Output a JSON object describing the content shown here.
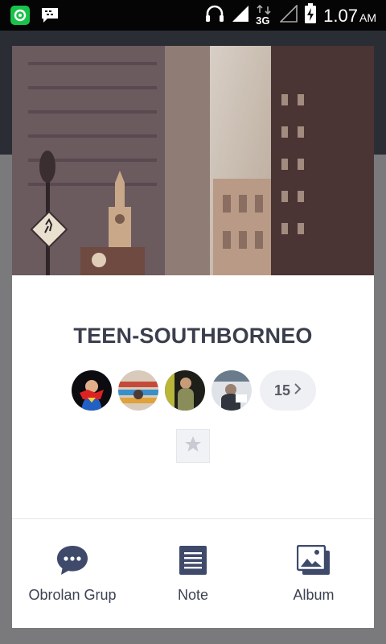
{
  "status_bar": {
    "time": "1.07",
    "ampm": "AM",
    "network": "3G",
    "icons": [
      "line-app-icon",
      "bbm-icon",
      "headset-icon",
      "signal-icon",
      "data-3g-icon",
      "signal-empty-icon",
      "battery-charging-icon"
    ]
  },
  "group": {
    "name": "TEEN-SOUTHBORNEO",
    "member_more_count": "15",
    "member_avatars": [
      "superman-avatar",
      "library-avatar",
      "selfie-avatar",
      "photo-avatar"
    ]
  },
  "actions": [
    {
      "label": "Obrolan Grup",
      "icon": "chat-bubble-icon"
    },
    {
      "label": "Note",
      "icon": "note-icon"
    },
    {
      "label": "Album",
      "icon": "album-icon"
    }
  ],
  "colors": {
    "accent": "#3f4a6b",
    "title": "#3a3e4d",
    "status_bar": "#050505",
    "overlay": "#6f6f72"
  }
}
